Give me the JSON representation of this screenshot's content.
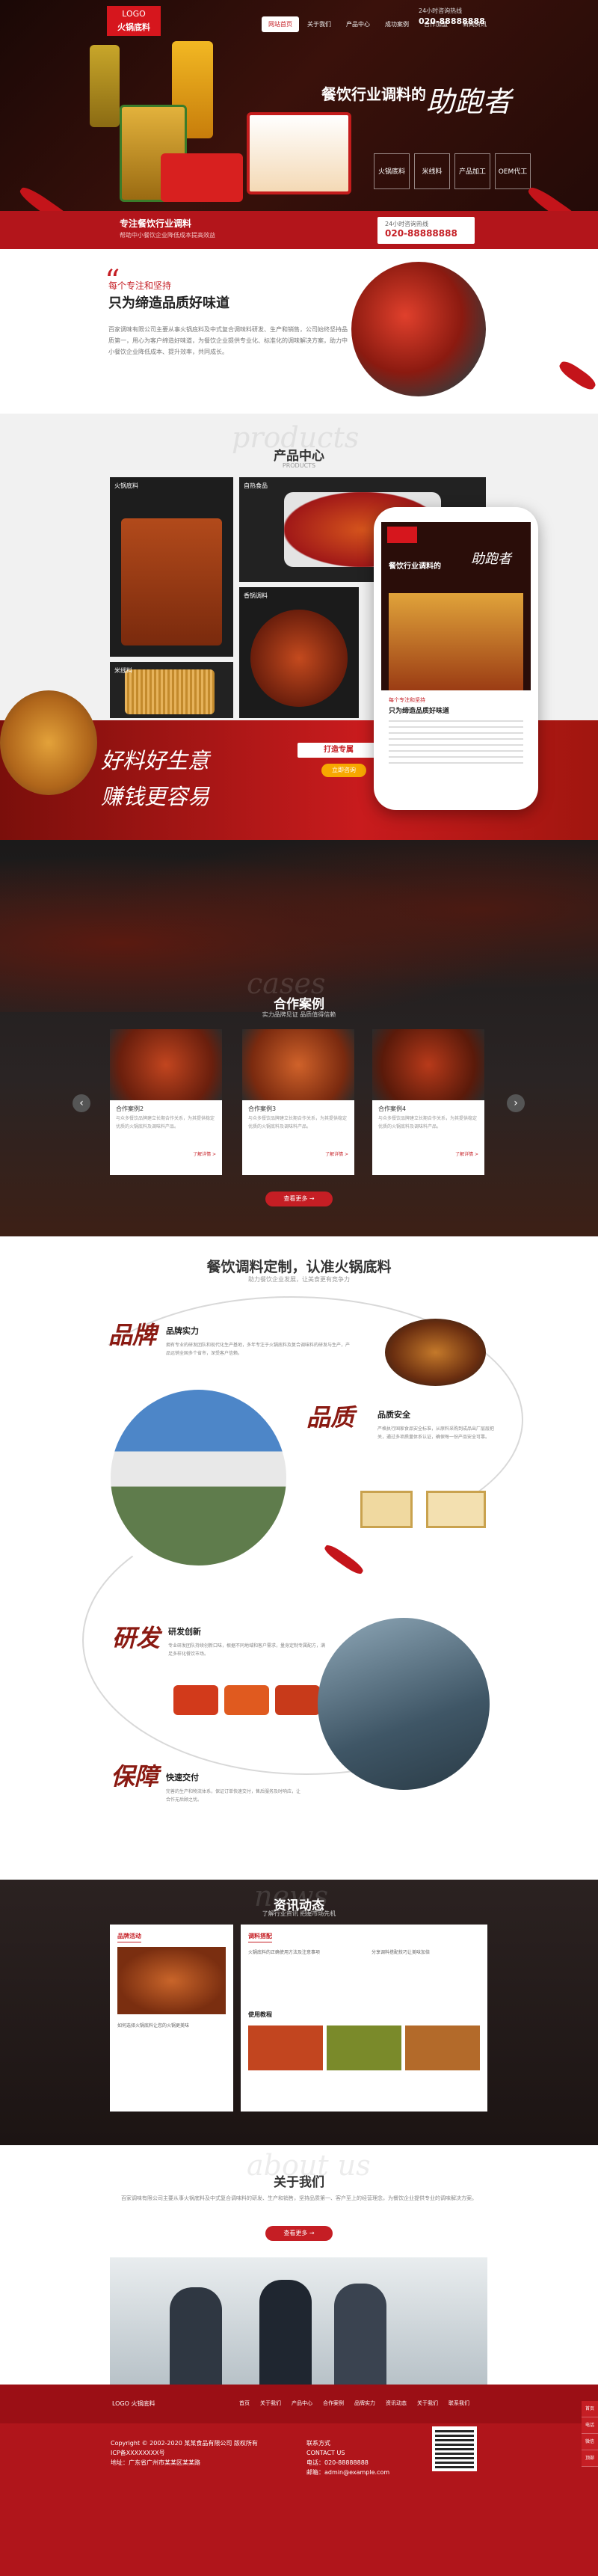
{
  "header": {
    "logo_top": "LOGO",
    "logo_brand": "火锅底料",
    "nav": [
      "网站首页",
      "关于我们",
      "产品中心",
      "成功案例",
      "合作加盟",
      "新闻资讯",
      "联系我们"
    ],
    "hotline_label": "24小时咨询热线",
    "hotline_number": "020-88888888"
  },
  "hero": {
    "slogan": "餐饮行业调料的",
    "slogan_big": "助跑者",
    "boxes": [
      "火锅底料",
      "米线料",
      "产品加工",
      "OEM代工"
    ],
    "bar_title": "专注餐饮行业调料",
    "bar_sub": "帮助中小餐饮企业降低成本提高效益",
    "tel_label": "24小时咨询热线",
    "tel_number": "020-88888888"
  },
  "about": {
    "tag": "每个专注和坚持",
    "title": "只为缔造品质好味道",
    "text": "百家调味有限公司主要从事火锅底料及中式复合调味料研发、生产和销售，公司始终坚持品质第一，用心为客户缔造好味道，为餐饮企业提供专业化、标准化的调味解决方案，助力中小餐饮企业降低成本、提升效率，共同成长。"
  },
  "products": {
    "ghost": "products",
    "title": "产品中心",
    "sub": "PRODUCTS",
    "cards": [
      "火锅底料",
      "自热食品",
      "香锅调料",
      "米线料"
    ],
    "slogan_line1": "好料好生意",
    "slogan_line2": "赚钱更容易",
    "badge": "打造专属",
    "button": "立即咨询",
    "phone_slogan": "餐饮行业调料的",
    "phone_big": "助跑者",
    "phone_tag": "每个专注和坚持",
    "phone_title": "只为缔造品质好味道"
  },
  "cases": {
    "ghost": "cases",
    "title": "合作案例",
    "sub": "实力品牌见证 品质值得信赖",
    "items": [
      {
        "title": "合作案例2",
        "desc": "与众多餐饮品牌建立长期合作关系，为其提供稳定优质的火锅底料及调味料产品。",
        "more": "了解详情 >"
      },
      {
        "title": "合作案例3",
        "desc": "与众多餐饮品牌建立长期合作关系，为其提供稳定优质的火锅底料及调味料产品。",
        "more": "了解详情 >"
      },
      {
        "title": "合作案例4",
        "desc": "与众多餐饮品牌建立长期合作关系，为其提供稳定优质的火锅底料及调味料产品。",
        "more": "了解详情 >"
      }
    ],
    "more_button": "查看更多 →"
  },
  "advantages": {
    "title": "餐饮调料定制，认准火锅底料",
    "sub": "助力餐饮企业发展，让美食更有竞争力",
    "items": [
      {
        "calli": "品牌",
        "heading": "品牌实力",
        "desc": "拥有专业的研发团队和现代化生产基地，多年专注于火锅底料及复合调味料的研发与生产，产品远销全国多个省市，深受客户信赖。"
      },
      {
        "calli": "品质",
        "heading": "品质安全",
        "desc": "严格执行国家食品安全标准，从原料采购到成品出厂层层把关，通过多项质量体系认证，确保每一份产品安全可靠。"
      },
      {
        "calli": "研发",
        "heading": "研发创新",
        "desc": "专业研发团队持续创新口味，根据不同地域和客户需求，量身定制专属配方，满足多样化餐饮市场。"
      },
      {
        "calli": "保障",
        "heading": "快速交付",
        "desc": "完善的生产和物流体系，保证订单快速交付，售后服务及时响应，让合作无后顾之忧。"
      }
    ]
  },
  "news": {
    "ghost": "news",
    "title": "资讯动态",
    "sub": "了解行业资讯 把握市场先机",
    "tabs": [
      "品牌活动",
      "调料搭配",
      "使用教程"
    ],
    "col1_item": "如何选择火锅底料让您的火锅更美味",
    "col2_items": [
      "火锅底料的正确使用方法及注意事项",
      "分享调料搭配技巧让美味加倍"
    ]
  },
  "aboutus": {
    "ghost": "about us",
    "title": "关于我们",
    "text": "百家调味有限公司主要从事火锅底料及中式复合调味料的研发、生产和销售，坚持品质第一、客户至上的经营理念，为餐饮企业提供专业的调味解决方案。",
    "button": "查看更多 →"
  },
  "footer": {
    "logo": "LOGO 火锅底料",
    "nav": [
      "首页",
      "关于我们",
      "产品中心",
      "合作案例",
      "品牌实力",
      "资讯动态",
      "关于我们",
      "联系我们"
    ],
    "copyright": "Copyright © 2002-2020 某某食品有限公司 版权所有",
    "icp": "ICP备XXXXXXXX号",
    "address": "地址：广东省广州市某某区某某路",
    "contact_title": "联系方式",
    "contact_sub": "CONTACT US",
    "contact_tel": "电话：020-88888888",
    "contact_mail": "邮箱：admin@example.com",
    "side_items": [
      "首页",
      "电话",
      "微信",
      "顶部"
    ]
  },
  "colors": {
    "accent": "#c51e24",
    "dark": "#1c1413"
  }
}
